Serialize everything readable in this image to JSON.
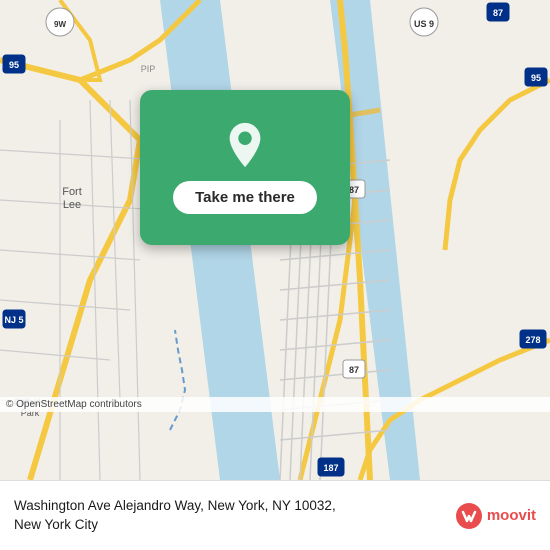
{
  "map": {
    "attribution": "© OpenStreetMap contributors",
    "background_color": "#e8e0d8"
  },
  "card": {
    "button_label": "Take me there"
  },
  "footer": {
    "address_line1": "Washington Ave Alejandro Way, New York, NY 10032,",
    "address_line2": "New York City",
    "logo_text": "moovit"
  },
  "icons": {
    "pin": "location-pin-icon",
    "moovit": "moovit-brand-icon"
  }
}
